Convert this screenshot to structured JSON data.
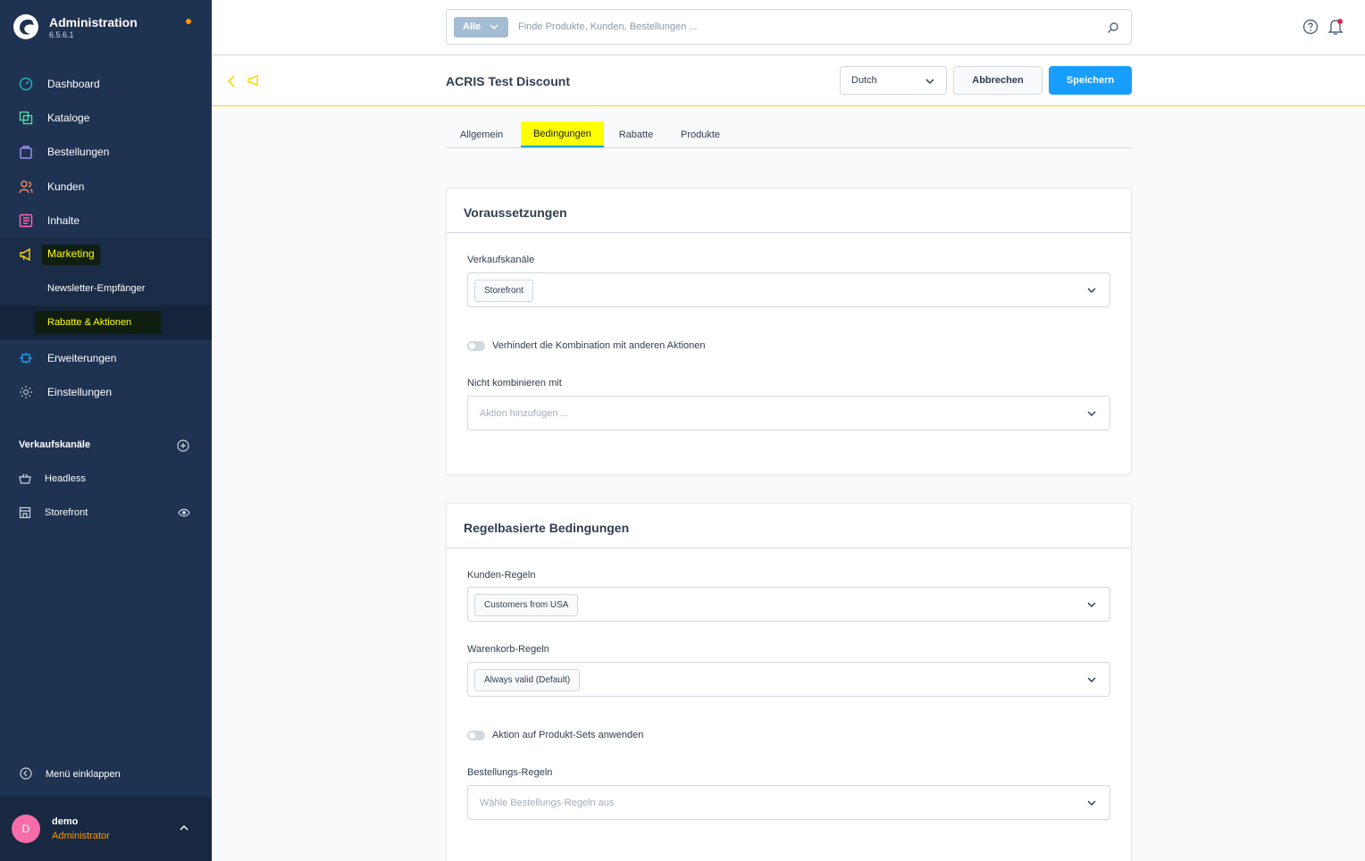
{
  "brand": {
    "title": "Administration",
    "version": "6.5.6.1"
  },
  "nav": {
    "dashboard": "Dashboard",
    "kataloge": "Kataloge",
    "bestellungen": "Bestellungen",
    "kunden": "Kunden",
    "inhalte": "Inhalte",
    "marketing": "Marketing",
    "newsletter": "Newsletter-Empfänger",
    "rabatte": "Rabatte & Aktionen",
    "erweiterungen": "Erweiterungen",
    "einstellungen": "Einstellungen"
  },
  "channels": {
    "title": "Verkaufskanäle",
    "items": [
      "Headless",
      "Storefront"
    ]
  },
  "collapse_label": "Menü einklappen",
  "user": {
    "initial": "D",
    "name": "demo",
    "role": "Administrator"
  },
  "search": {
    "scope": "Alle",
    "placeholder": "Finde Produkte, Kunden, Bestellungen ..."
  },
  "smartbar": {
    "title": "ACRIS Test Discount",
    "language": "Dutch",
    "cancel_label": "Abbrechen",
    "save_label": "Speichern"
  },
  "tabs": [
    "Allgemein",
    "Bedingungen",
    "Rabatte",
    "Produkte"
  ],
  "voraussetzungen": {
    "title": "Voraussetzungen",
    "sales_channels_label": "Verkaufskanäle",
    "sales_channels_value": "Storefront",
    "prevent_combination_label": "Verhindert die Kombination mit anderen Aktionen",
    "not_combine_label": "Nicht kombinieren mit",
    "not_combine_placeholder": "Aktion hinzufügen ..."
  },
  "regeln": {
    "title": "Regelbasierte Bedingungen",
    "customer_rules_label": "Kunden-Regeln",
    "customer_rules_value": "Customers from USA",
    "cart_rules_label": "Warenkorb-Regeln",
    "cart_rules_value": "Always valid (Default)",
    "product_sets_label": "Aktion auf Produkt-Sets anwenden",
    "order_rules_label": "Bestellungs-Regeln",
    "order_rules_placeholder": "Wähle Bestellungs-Regeln aus"
  },
  "colors": {
    "sidebar": "#1e3251",
    "accent": "#189eff",
    "highlight": "#ffff00",
    "orange": "#ff9800"
  }
}
